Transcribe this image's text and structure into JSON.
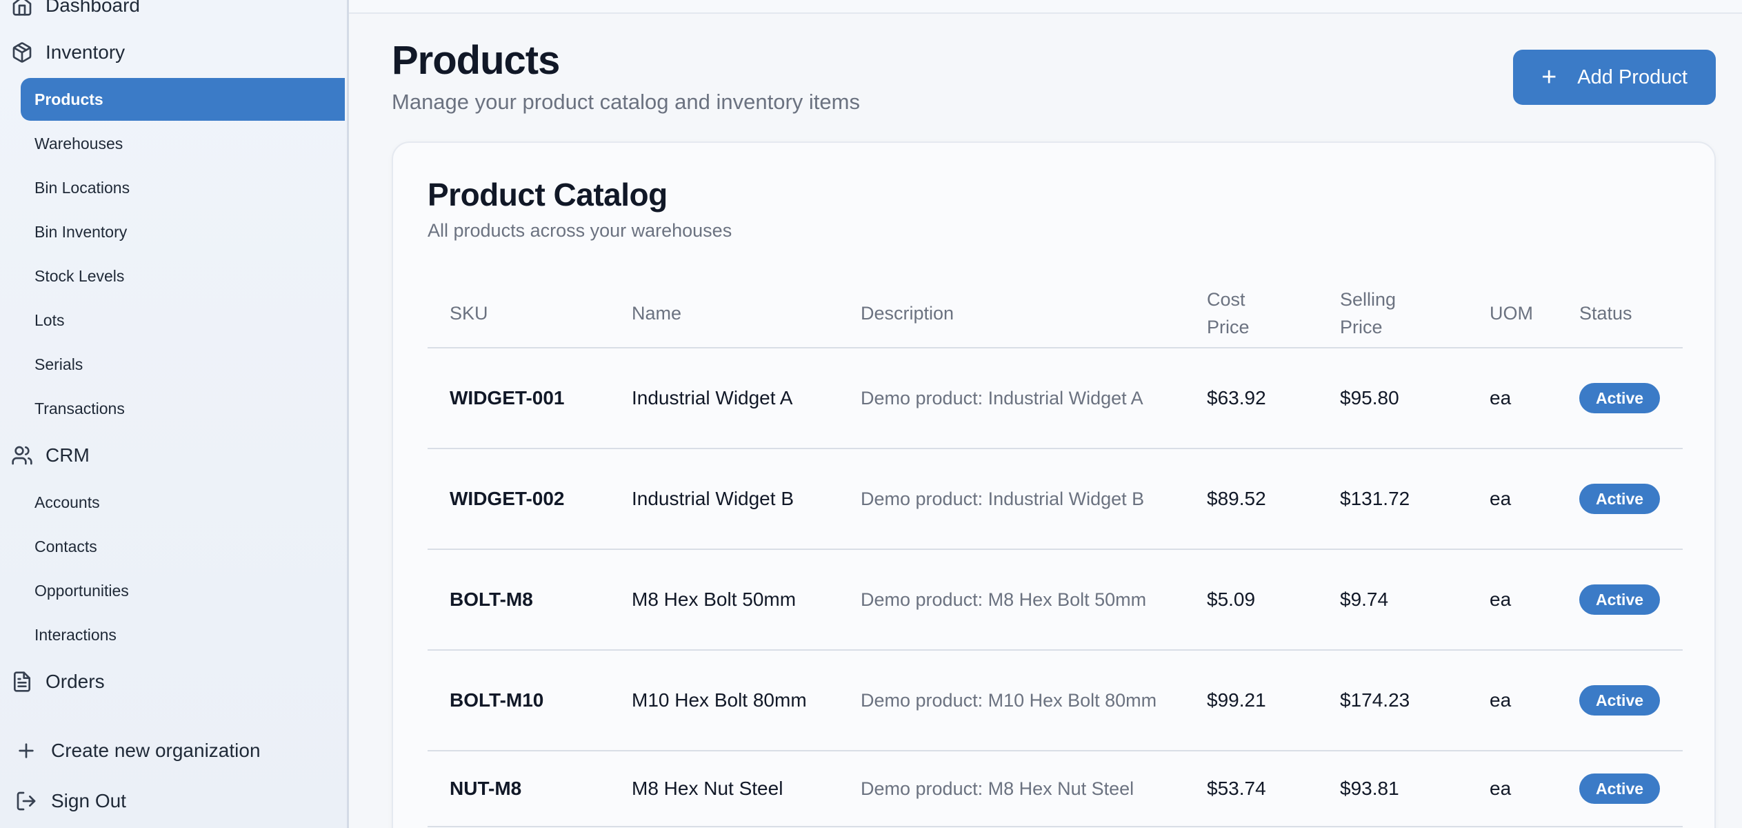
{
  "sidebar": {
    "sections": {
      "dashboard": "Dashboard",
      "inventory": "Inventory",
      "crm": "CRM",
      "orders": "Orders"
    },
    "inventory_items": [
      {
        "label": "Products",
        "active": true
      },
      {
        "label": "Warehouses"
      },
      {
        "label": "Bin Locations"
      },
      {
        "label": "Bin Inventory"
      },
      {
        "label": "Stock Levels"
      },
      {
        "label": "Lots"
      },
      {
        "label": "Serials"
      },
      {
        "label": "Transactions"
      }
    ],
    "crm_items": [
      {
        "label": "Accounts"
      },
      {
        "label": "Contacts"
      },
      {
        "label": "Opportunities"
      },
      {
        "label": "Interactions"
      }
    ],
    "create_org": "Create new organization",
    "sign_out": "Sign Out"
  },
  "header": {
    "title": "Products",
    "subtitle": "Manage your product catalog and inventory items",
    "add_button": "Add Product",
    "add_icon": "plus-icon"
  },
  "catalog": {
    "title": "Product Catalog",
    "subtitle": "All products across your warehouses",
    "columns": {
      "sku": "SKU",
      "name": "Name",
      "description": "Description",
      "cost_price": "Cost Price",
      "selling_price": "Selling Price",
      "uom": "UOM",
      "status": "Status"
    },
    "rows": [
      {
        "sku": "WIDGET-001",
        "name": "Industrial Widget A",
        "description": "Demo product: Industrial Widget A",
        "cost": "$63.92",
        "sell": "$95.80",
        "uom": "ea",
        "status": "Active"
      },
      {
        "sku": "WIDGET-002",
        "name": "Industrial Widget B",
        "description": "Demo product: Industrial Widget B",
        "cost": "$89.52",
        "sell": "$131.72",
        "uom": "ea",
        "status": "Active"
      },
      {
        "sku": "BOLT-M8",
        "name": "M8 Hex Bolt 50mm",
        "description": "Demo product: M8 Hex Bolt 50mm",
        "cost": "$5.09",
        "sell": "$9.74",
        "uom": "ea",
        "status": "Active"
      },
      {
        "sku": "BOLT-M10",
        "name": "M10 Hex Bolt 80mm",
        "description": "Demo product: M10 Hex Bolt 80mm",
        "cost": "$99.21",
        "sell": "$174.23",
        "uom": "ea",
        "status": "Active"
      },
      {
        "sku": "NUT-M8",
        "name": "M8 Hex Nut Steel",
        "description": "Demo product: M8 Hex Nut Steel",
        "cost": "$53.74",
        "sell": "$93.81",
        "uom": "ea",
        "status": "Active"
      }
    ]
  },
  "colors": {
    "accent": "#3b7bc7",
    "sidebar_bg": "#eef3f9"
  }
}
